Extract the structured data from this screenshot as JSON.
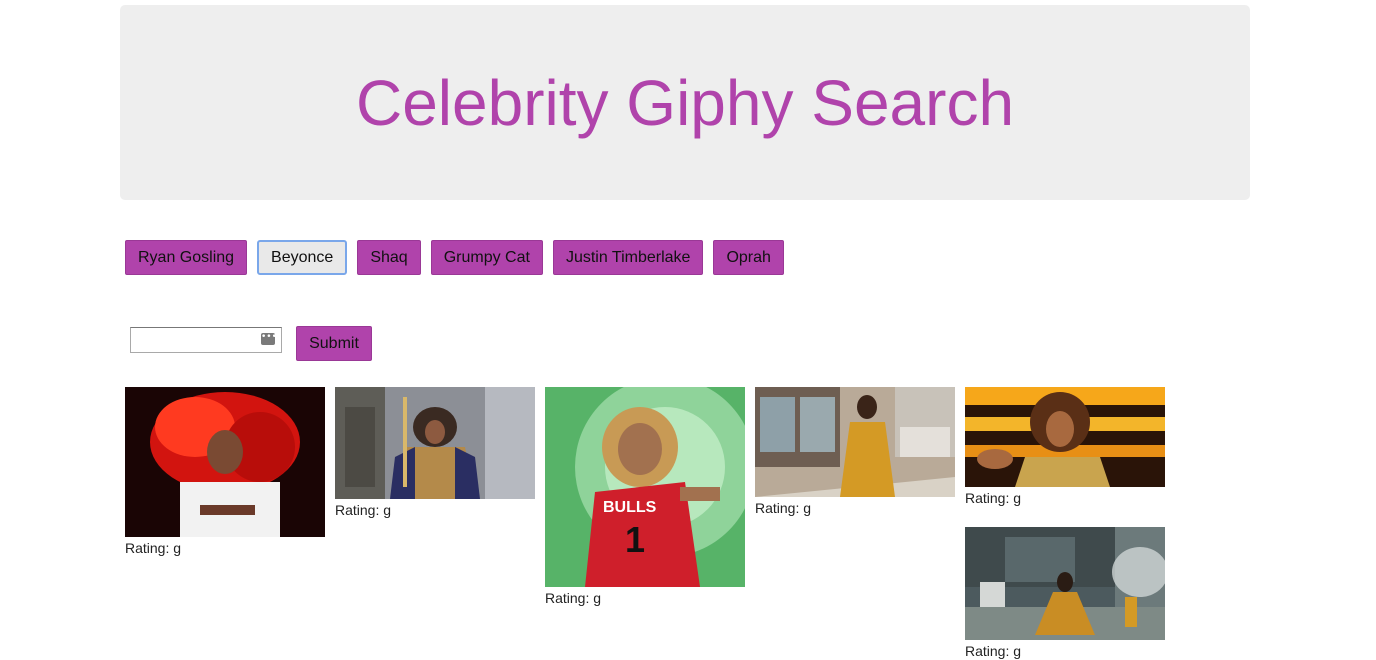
{
  "header": {
    "title": "Celebrity Giphy Search"
  },
  "buttons": [
    "Ryan Gosling",
    "Beyonce",
    "Shaq",
    "Grumpy Cat",
    "Justin Timberlake",
    "Oprah"
  ],
  "active_button": "Beyonce",
  "search": {
    "value": "",
    "placeholder": "",
    "submit_label": "Submit"
  },
  "results": [
    {
      "rating": "Rating: g"
    },
    {
      "rating": "Rating: g"
    },
    {
      "rating": "Rating: g"
    },
    {
      "rating": "Rating: g"
    },
    {
      "rating": "Rating: g"
    },
    {
      "rating": "Rating: g"
    }
  ],
  "colors": {
    "accent": "#b043ab",
    "jumbotron": "#eeeeee",
    "active_button_border": "#7aa7ea"
  },
  "icons": {
    "input_autofill": "ellipsis-key-icon"
  }
}
